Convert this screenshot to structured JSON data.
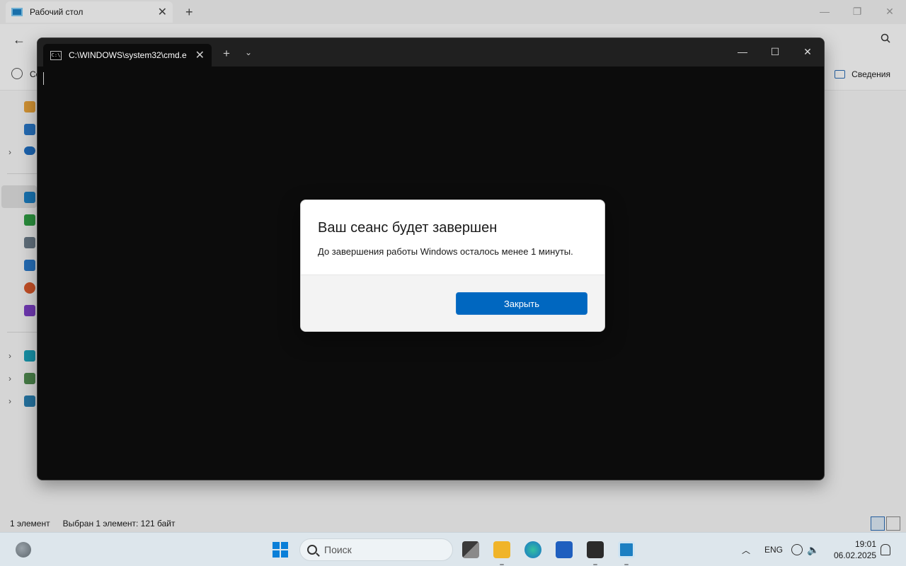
{
  "explorer": {
    "tab_title": "Рабочий стол",
    "create_label": "Со",
    "details_label": "Сведения",
    "status": {
      "items_count": "1 элемент",
      "selection": "Выбран 1 элемент: 121 байт"
    }
  },
  "terminal": {
    "tab_title": "C:\\WINDOWS\\system32\\cmd.e",
    "cmd_icon_text": "C:\\"
  },
  "dialog": {
    "title": "Ваш сеанс будет завершен",
    "message": "До завершения работы Windows осталось менее 1 минуты.",
    "close_button": "Закрыть"
  },
  "taskbar": {
    "search_placeholder": "Поиск",
    "language": "ENG",
    "time": "19:01",
    "date": "06.02.2025"
  },
  "colors": {
    "accent": "#0067c0",
    "terminal_bg": "#0c0c0c",
    "taskbar_bg": "#dde6ec"
  }
}
